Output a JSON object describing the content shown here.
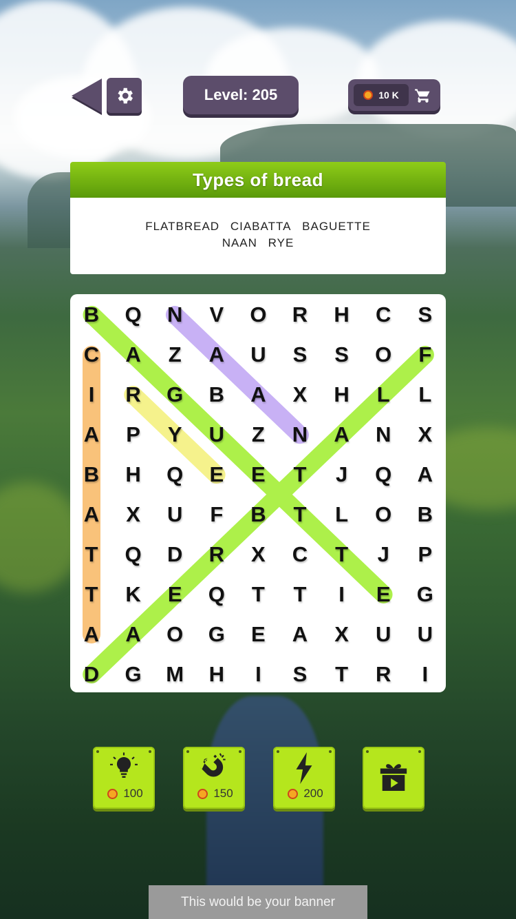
{
  "header": {
    "level_label": "Level: 205",
    "coins": "10 K"
  },
  "category": {
    "title": "Types of bread",
    "words_line1": [
      "FLATBREAD",
      "CIABATTA",
      "BAGUETTE"
    ],
    "words_line2": [
      "NAAN",
      "RYE"
    ]
  },
  "grid": {
    "rows": [
      [
        "B",
        "Q",
        "N",
        "V",
        "O",
        "R",
        "H",
        "C",
        "S"
      ],
      [
        "C",
        "A",
        "Z",
        "A",
        "U",
        "S",
        "S",
        "O",
        "F"
      ],
      [
        "I",
        "R",
        "G",
        "B",
        "A",
        "X",
        "H",
        "L",
        "L"
      ],
      [
        "A",
        "P",
        "Y",
        "U",
        "Z",
        "N",
        "A",
        "N",
        "X"
      ],
      [
        "B",
        "H",
        "Q",
        "E",
        "E",
        "T",
        "J",
        "Q",
        "A"
      ],
      [
        "A",
        "X",
        "U",
        "F",
        "B",
        "T",
        "L",
        "O",
        "B"
      ],
      [
        "T",
        "Q",
        "D",
        "R",
        "X",
        "C",
        "T",
        "J",
        "P"
      ],
      [
        "T",
        "K",
        "E",
        "Q",
        "T",
        "T",
        "I",
        "E",
        "G"
      ],
      [
        "A",
        "A",
        "O",
        "G",
        "E",
        "A",
        "X",
        "U",
        "U"
      ],
      [
        "D",
        "G",
        "M",
        "H",
        "I",
        "S",
        "T",
        "R",
        "I"
      ]
    ],
    "found": [
      {
        "word": "BAGUETTE",
        "color": "#adf04a",
        "from": [
          0,
          0
        ],
        "to": [
          7,
          7
        ]
      },
      {
        "word": "FLATBREAD",
        "color": "#adf04a",
        "from": [
          1,
          8
        ],
        "to": [
          9,
          0
        ]
      },
      {
        "word": "CIABATTA",
        "color": "#f9c27a",
        "from": [
          1,
          0
        ],
        "to": [
          8,
          0
        ]
      },
      {
        "word": "NAAN",
        "color": "#c8b1f5",
        "from": [
          0,
          2
        ],
        "to": [
          3,
          5
        ]
      },
      {
        "word": "RYE",
        "color": "#f5f28c",
        "from": [
          2,
          1
        ],
        "to": [
          4,
          3
        ]
      }
    ]
  },
  "powerups": [
    {
      "name": "hint",
      "icon": "lightbulb-icon",
      "cost": "100"
    },
    {
      "name": "magnet",
      "icon": "magnet-icon",
      "cost": "150"
    },
    {
      "name": "lightning",
      "icon": "lightning-icon",
      "cost": "200"
    },
    {
      "name": "gift",
      "icon": "gift-video-icon",
      "cost": ""
    }
  ],
  "banner": "This would be your banner",
  "colors": {
    "panel": "#5c4d6b",
    "accent_green": "#8fcc18",
    "powerup": "#b5e61d",
    "coin": "#f5a623"
  }
}
